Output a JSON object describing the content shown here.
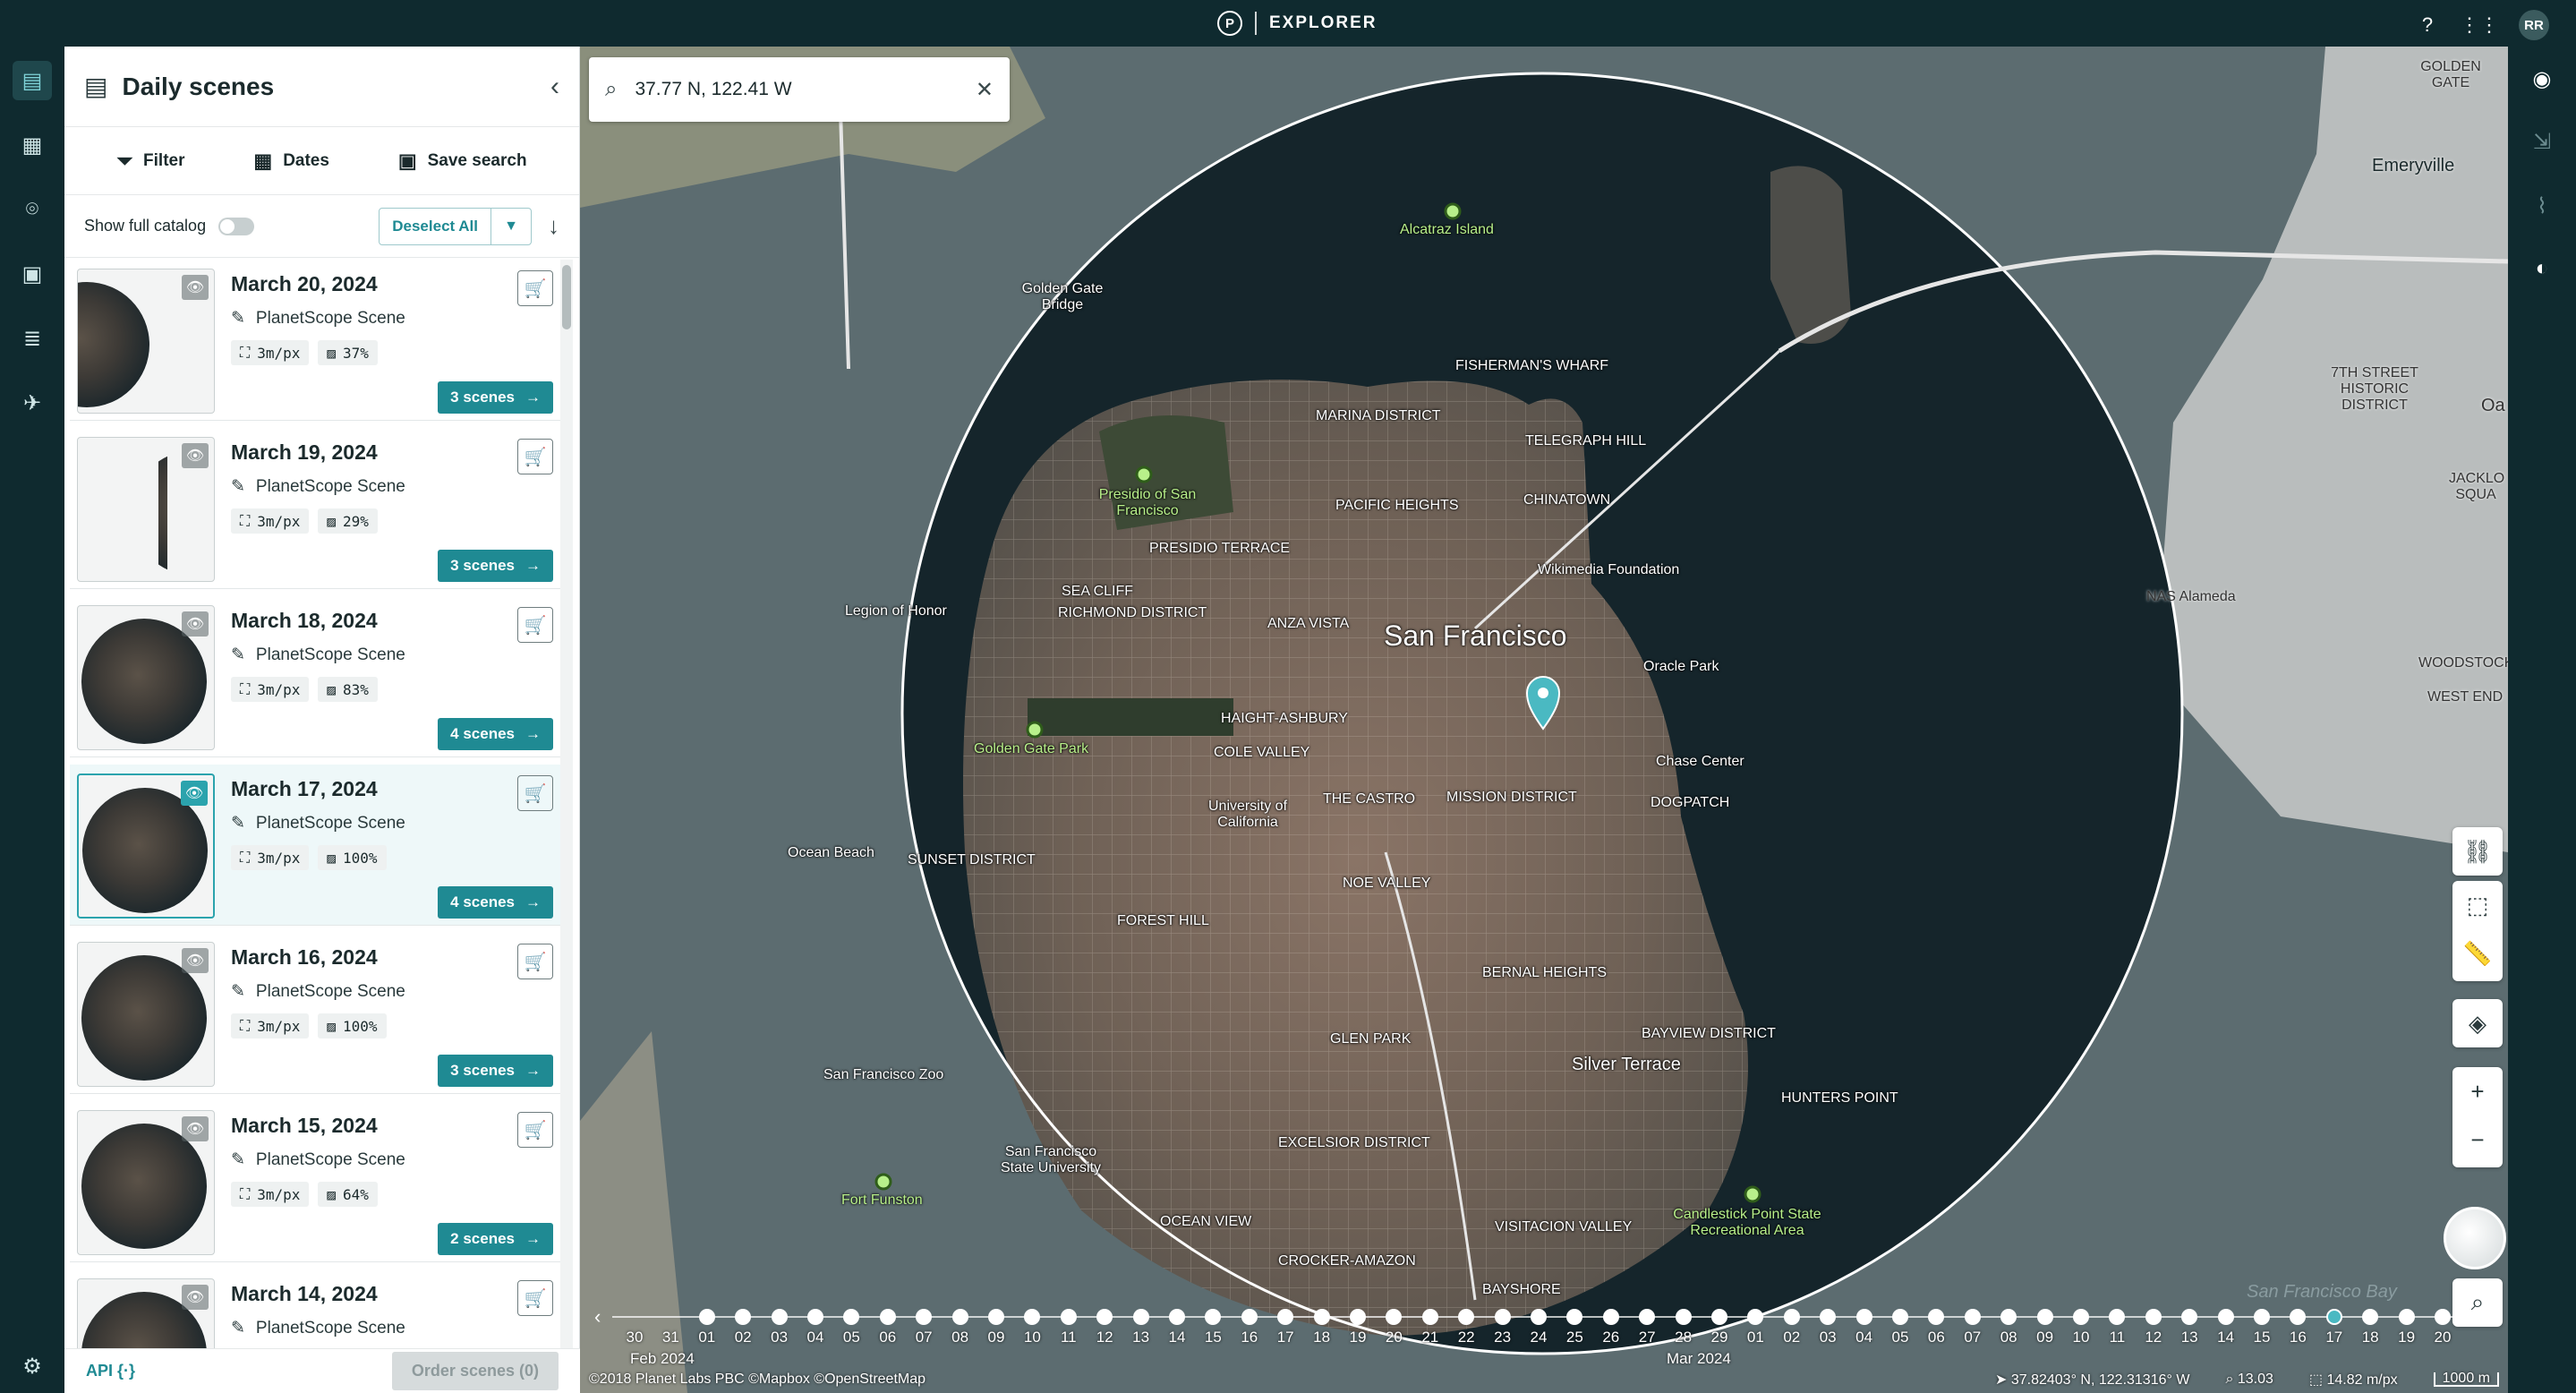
{
  "topbar": {
    "logo_letter": "P",
    "title": "EXPLORER",
    "avatar": "RR",
    "icons": [
      "help-icon",
      "apps-grid-icon"
    ]
  },
  "left_rail": {
    "items": [
      "daily-scenes-icon",
      "mosaics-icon",
      "places-icon",
      "map-layers-icon",
      "tasks-icon",
      "satellite-icon",
      "settings-icon"
    ]
  },
  "panel": {
    "title": "Daily scenes",
    "filter_label": "Filter",
    "dates_label": "Dates",
    "save_label": "Save search",
    "catalog_label": "Show full catalog",
    "deselect_label": "Deselect All",
    "api_label": "API {·}",
    "order_label": "Order scenes (0)"
  },
  "scenes": [
    {
      "date": "March 20, 2024",
      "type": "PlanetScope Scene",
      "res": "3m/px",
      "cover": "37%",
      "count": "3 scenes",
      "selected": false,
      "thumb": "half"
    },
    {
      "date": "March 19, 2024",
      "type": "PlanetScope Scene",
      "res": "3m/px",
      "cover": "29%",
      "count": "3 scenes",
      "selected": false,
      "thumb": "sliver"
    },
    {
      "date": "March 18, 2024",
      "type": "PlanetScope Scene",
      "res": "3m/px",
      "cover": "83%",
      "count": "4 scenes",
      "selected": false,
      "thumb": "full"
    },
    {
      "date": "March 17, 2024",
      "type": "PlanetScope Scene",
      "res": "3m/px",
      "cover": "100%",
      "count": "4 scenes",
      "selected": true,
      "thumb": "full"
    },
    {
      "date": "March 16, 2024",
      "type": "PlanetScope Scene",
      "res": "3m/px",
      "cover": "100%",
      "count": "3 scenes",
      "selected": false,
      "thumb": "full"
    },
    {
      "date": "March 15, 2024",
      "type": "PlanetScope Scene",
      "res": "3m/px",
      "cover": "64%",
      "count": "2 scenes",
      "selected": false,
      "thumb": "full"
    },
    {
      "date": "March 14, 2024",
      "type": "PlanetScope Scene",
      "res": "3m/px",
      "cover": "",
      "count": "",
      "selected": false,
      "thumb": "full"
    }
  ],
  "search": {
    "value": "37.77 N, 122.41 W",
    "placeholder": ""
  },
  "map_labels": {
    "city": "San Francisco",
    "alcatraz": "Alcatraz Island",
    "ggbridge": "Golden Gate Bridge",
    "presidio": "Presidio of San Francisco",
    "ggpark": "Golden Gate Park",
    "fisherman": "FISHERMAN'S WHARF",
    "marina": "MARINA DISTRICT",
    "telegraph": "TELEGRAPH HILL",
    "chinatown": "CHINATOWN",
    "pacific": "PACIFIC HEIGHTS",
    "richmond": "RICHMOND DISTRICT",
    "anza": "ANZA VISTA",
    "haight": "HAIGHT-ASHBURY",
    "cole": "COLE VALLEY",
    "castro": "THE CASTRO",
    "mission": "MISSION DISTRICT",
    "noe": "NOE VALLEY",
    "sunset": "SUNSET DISTRICT",
    "forest": "FOREST HILL",
    "bernal": "BERNAL HEIGHTS",
    "glen": "GLEN PARK",
    "excelsior": "EXCELSIOR DISTRICT",
    "bayview": "BAYVIEW DISTRICT",
    "hunters": "HUNTERS POINT",
    "silver": "Silver Terrace",
    "candlestick": "Candlestick Point State Recreational Area",
    "funston": "Fort Funston",
    "oracle": "Oracle Park",
    "chase": "Chase Center",
    "dogpatch": "DOGPATCH",
    "ucsf": "University of California",
    "sfsu": "San Francisco State University",
    "zoo": "San Francisco Zoo",
    "ocean_beach": "Ocean Beach",
    "legion": "Legion of Honor",
    "seacliff": "SEA CLIFF",
    "emeryville": "Emeryville",
    "nas": "NAS Alameda",
    "woodstock": "WOODSTOCK",
    "westend": "WEST END",
    "bay": "San Francisco Bay",
    "crocker": "CROCKER-AMAZON",
    "visitacion": "VISITACION VALLEY",
    "bayshore": "BAYSHORE",
    "ocean_view": "OCEAN VIEW",
    "wikimedia": "Wikimedia Foundation",
    "presidio_terrace": "PRESIDIO TERRACE",
    "golden_gate_top": "GOLDEN GATE",
    "seventh": "7TH STREET HISTORIC DISTRICT",
    "jack": "JACKLO SQUA",
    "oa": "Oa"
  },
  "timeline": {
    "labels": [
      "30",
      "31",
      "01",
      "02",
      "03",
      "04",
      "05",
      "06",
      "07",
      "08",
      "09",
      "10",
      "11",
      "12",
      "13",
      "14",
      "15",
      "16",
      "17",
      "18",
      "19",
      "20",
      "21",
      "22",
      "23",
      "24",
      "25",
      "26",
      "27",
      "28",
      "29",
      "01",
      "02",
      "03",
      "04",
      "05",
      "06",
      "07",
      "08",
      "09",
      "10",
      "11",
      "12",
      "13",
      "14",
      "15",
      "16",
      "17",
      "18",
      "19",
      "20"
    ],
    "dots_from_index": 2,
    "selected_index": 47,
    "month_feb": "Feb 2024",
    "month_mar": "Mar 2024"
  },
  "status": {
    "attribution": "©2018 Planet Labs PBC ©Mapbox ©OpenStreetMap",
    "coords": "37.82403° N, 122.31316° W",
    "zoom": "13.03",
    "resolution": "14.82 m/px",
    "scale": "1000 m"
  },
  "colors": {
    "accent": "#1f8a93",
    "dark": "#0f2a2f"
  }
}
